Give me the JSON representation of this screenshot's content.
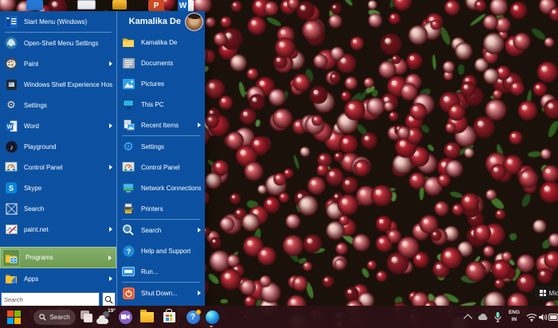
{
  "desktop": {
    "watermark_text": "Micro",
    "icons": {
      "powerpoint_letter": "P",
      "word_letter": "W"
    }
  },
  "start_menu": {
    "search_placeholder": "Search",
    "left_items": [
      {
        "label": "Start Menu (Windows)",
        "arrow": false
      },
      {
        "label": "Open-Shell Menu Settings",
        "arrow": false
      },
      {
        "label": "Paint",
        "arrow": true
      },
      {
        "label": "Windows Shell Experience Host",
        "arrow": false
      },
      {
        "label": "Settings",
        "arrow": false
      },
      {
        "label": "Word",
        "arrow": true
      },
      {
        "label": "Playground",
        "arrow": false
      },
      {
        "label": "Control Panel",
        "arrow": true
      },
      {
        "label": "Skype",
        "arrow": false
      },
      {
        "label": "Search",
        "arrow": false
      },
      {
        "label": "paint.net",
        "arrow": true
      },
      {
        "label": "Programs",
        "arrow": true,
        "highlighted": true
      },
      {
        "label": "Apps",
        "arrow": true
      }
    ],
    "right_header": {
      "name": "Kamalika De"
    },
    "right_items": [
      {
        "label": "Kamalika De"
      },
      {
        "label": "Documents"
      },
      {
        "label": "Pictures"
      },
      {
        "label": "This PC"
      },
      {
        "label": "Recent Items",
        "arrow": true
      },
      {
        "label": "Settings"
      },
      {
        "label": "Control Panel"
      },
      {
        "label": "Network Connections"
      },
      {
        "label": "Printers"
      },
      {
        "label": "Search",
        "arrow": true
      },
      {
        "label": "Help and Support"
      },
      {
        "label": "Run..."
      },
      {
        "label": "Shut Down...",
        "arrow": true
      }
    ]
  },
  "taskbar": {
    "search_label": "Search",
    "weather_temp": "19°",
    "language_top": "ENG",
    "language_bottom": "IN",
    "help_mark": "?"
  },
  "colors": {
    "menu_blue": "#0c51a1",
    "highlight_green": "#79a55f",
    "taskbar": "#2b1115",
    "accent_blue": "#2196e0"
  }
}
